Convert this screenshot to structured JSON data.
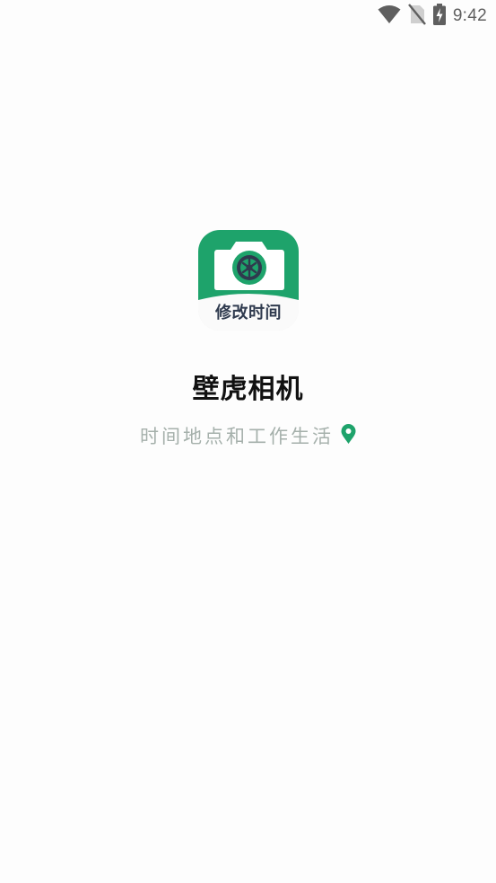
{
  "status_bar": {
    "time": "9:42",
    "icons": [
      "wifi-icon",
      "no-sim-icon",
      "battery-charging-icon"
    ]
  },
  "app_icon": {
    "label": "修改时间",
    "brand_color": "#1ea36b",
    "icon": "camera-icon"
  },
  "app_name": "壁虎相机",
  "slogan": {
    "text": "时间地点和工作生活",
    "icon": "location-pin-icon",
    "icon_color": "#1ea36b"
  }
}
